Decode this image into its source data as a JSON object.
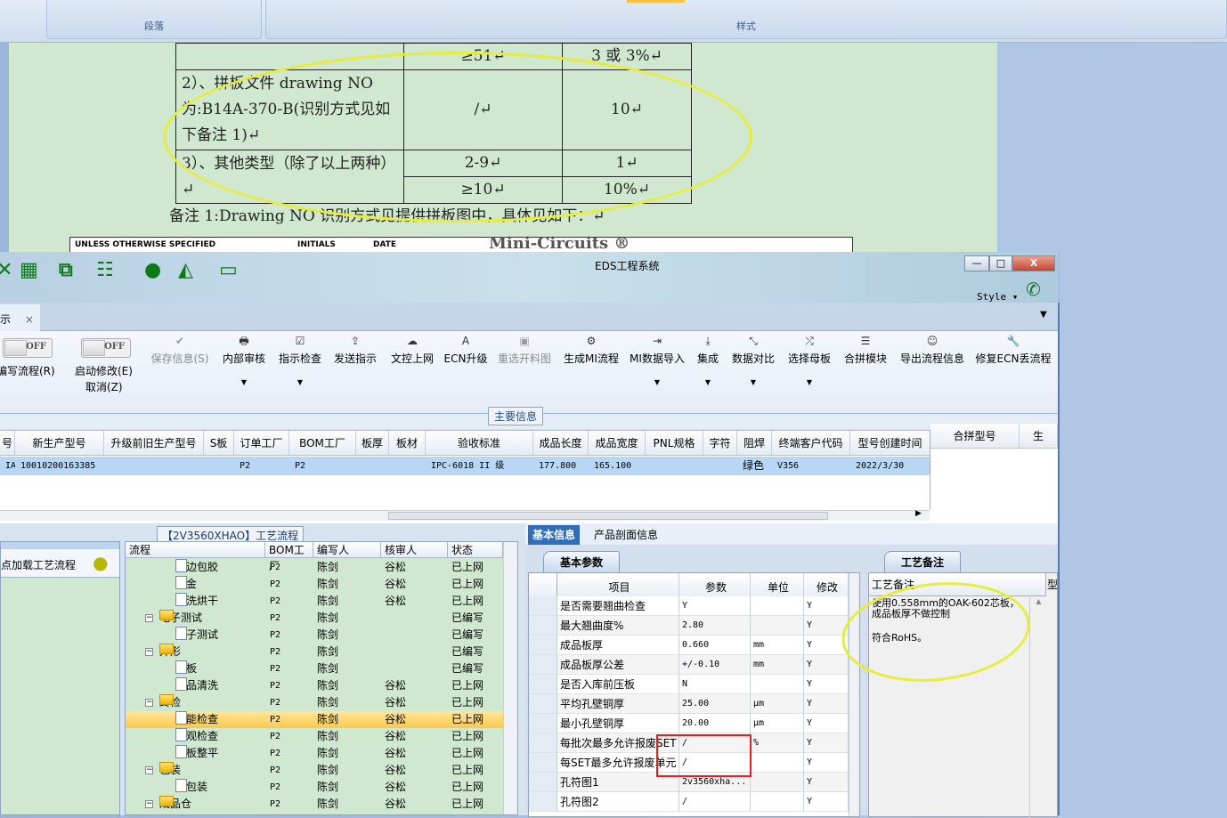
{
  "word": {
    "ribbon_groups": [
      "段落",
      "样式"
    ],
    "table": [
      [
        "",
        "≥51↵",
        "3 或 3%↵"
      ],
      [
        "2）、拼板文件 drawing NO 为:B14A-370-B(识别方式见如下备注 1)↵",
        "/↵",
        "10↵"
      ],
      [
        "3）、其他类型（除了以上两种）↵",
        "2-9↵",
        "1↵"
      ],
      [
        "",
        "≥10↵",
        "10%↵"
      ]
    ],
    "note": "备注 1:Drawing NO 识别方式见提供拼板图中，具体见如下：↵",
    "drawing_strip": [
      "UNLESS OTHERWISE SPECIFIED",
      "INITIALS",
      "DATE",
      "Mini-Circuits ®"
    ]
  },
  "app": {
    "title": "EDS工程系统",
    "style_label": "Style ▾",
    "window_controls": {
      "minimize": "—",
      "maximize": "□",
      "close": "X"
    },
    "doc_tab": {
      "label": "示",
      "close": "×"
    },
    "toggles": [
      {
        "state": "OFF",
        "label": "编写流程(R)"
      },
      {
        "state": "OFF",
        "label": "启动修改(E)",
        "label2": "取消(Z)"
      }
    ],
    "toolbar": [
      {
        "label": "保存信息(S)",
        "icon": "✔",
        "disabled": true
      },
      {
        "label": "内部审核",
        "icon": "🖶",
        "dropdown": true
      },
      {
        "label": "指示检查",
        "icon": "☑",
        "dropdown": true
      },
      {
        "label": "发送指示",
        "icon": "⇪"
      },
      {
        "label": "文控上网",
        "icon": "☁"
      },
      {
        "label": "ECN升级",
        "icon": "A"
      },
      {
        "label": "重选开料图",
        "icon": "▣",
        "disabled": true
      },
      {
        "label": "生成MI流程",
        "icon": "⚙"
      },
      {
        "label": "MI数据导入",
        "icon": "⇥",
        "dropdown": true
      },
      {
        "label": "集成",
        "icon": "⤓",
        "dropdown": true
      },
      {
        "label": "数据对比",
        "icon": "⤡",
        "dropdown": true
      },
      {
        "label": "选择母板",
        "icon": "⤮",
        "dropdown": true
      },
      {
        "label": "合拼模块",
        "icon": "☰"
      },
      {
        "label": "导出流程信息",
        "icon": "☺"
      },
      {
        "label": "修复ECN丢流程",
        "icon": "🔧"
      }
    ],
    "group_label": "主要信息",
    "grid": {
      "columns": [
        "号",
        "新生产型号",
        "升级前旧生产型号",
        "S板",
        "订单工厂",
        "BOM工厂",
        "板厚",
        "板材",
        "验收标准",
        "成品长度",
        "成品宽度",
        "PNL规格",
        "字符",
        "阻焊",
        "终端客户代码",
        "型号创建时间"
      ],
      "row": [
        "IAO",
        "10010200163385",
        "",
        "",
        "P2",
        "P2",
        "",
        "",
        "IPC-6018 II 级",
        "177.800",
        "165.100",
        "",
        "",
        "绿色",
        "V356",
        "2022/3/30"
      ],
      "side_columns": [
        "合拼型号",
        "生"
      ]
    },
    "left_panel": {
      "label": "点加载工艺流程"
    },
    "tree": {
      "caption": "【2V3560XHAO】工艺流程",
      "columns": [
        "流程",
        "BOM工厂",
        "编写人",
        "核审人",
        "状态"
      ],
      "rows": [
        {
          "name": "板边包胶",
          "type": "file",
          "bom": "P2",
          "writer": "陈剑",
          "reviewer": "谷松",
          "status": "已上网"
        },
        {
          "name": "沉金",
          "type": "file",
          "bom": "P2",
          "writer": "陈剑",
          "reviewer": "谷松",
          "status": "已上网"
        },
        {
          "name": "水洗烘干",
          "type": "file",
          "bom": "P2",
          "writer": "陈剑",
          "reviewer": "谷松",
          "status": "已上网"
        },
        {
          "name": "电子测试",
          "type": "folder",
          "bom": "P2",
          "writer": "陈剑",
          "reviewer": "",
          "status": "已编写"
        },
        {
          "name": "电子测试",
          "type": "file",
          "bom": "P2",
          "writer": "陈剑",
          "reviewer": "",
          "status": "已编写"
        },
        {
          "name": "外形",
          "type": "folder",
          "bom": "P2",
          "writer": "陈剑",
          "reviewer": "",
          "status": "已编写"
        },
        {
          "name": "铣板",
          "type": "file",
          "bom": "P2",
          "writer": "陈剑",
          "reviewer": "",
          "status": "已编写"
        },
        {
          "name": "成品清洗",
          "type": "file",
          "bom": "P2",
          "writer": "陈剑",
          "reviewer": "谷松",
          "status": "已上网"
        },
        {
          "name": "终检",
          "type": "folder",
          "bom": "P2",
          "writer": "陈剑",
          "reviewer": "谷松",
          "status": "已上网"
        },
        {
          "name": "功能检查",
          "type": "file",
          "bom": "P2",
          "writer": "陈剑",
          "reviewer": "谷松",
          "status": "已上网",
          "selected": true
        },
        {
          "name": "外观检查",
          "type": "file",
          "bom": "P2",
          "writer": "陈剑",
          "reviewer": "谷松",
          "status": "已上网"
        },
        {
          "name": "烘板整平",
          "type": "file",
          "bom": "P2",
          "writer": "陈剑",
          "reviewer": "谷松",
          "status": "已上网"
        },
        {
          "name": "包装",
          "type": "folder",
          "bom": "P2",
          "writer": "陈剑",
          "reviewer": "谷松",
          "status": "已上网"
        },
        {
          "name": "内包装",
          "type": "file",
          "bom": "P2",
          "writer": "陈剑",
          "reviewer": "谷松",
          "status": "已上网"
        },
        {
          "name": "成品仓",
          "type": "folder",
          "bom": "P2",
          "writer": "陈剑",
          "reviewer": "谷松",
          "status": "已上网"
        }
      ]
    },
    "info_tabs": [
      "基本信息",
      "产品剖面信息"
    ],
    "params": {
      "tab": "基本参数",
      "columns": [
        "项目",
        "参数",
        "单位",
        "修改"
      ],
      "rows": [
        [
          "是否需要翘曲检查",
          "Y",
          "",
          "Y"
        ],
        [
          "最大翘曲度%",
          "2.80",
          "",
          "Y"
        ],
        [
          "成品板厚",
          "0.660",
          "mm",
          "Y"
        ],
        [
          "成品板厚公差",
          "+/-0.10",
          "mm",
          "Y"
        ],
        [
          "是否入库前压板",
          "N",
          "",
          "Y"
        ],
        [
          "平均孔壁铜厚",
          "25.00",
          "μm",
          "Y"
        ],
        [
          "最小孔壁铜厚",
          "20.00",
          "μm",
          "Y"
        ],
        [
          "每批次最多允许报废SET",
          "/",
          "%",
          "Y"
        ],
        [
          "每SET最多允许报废单元",
          "/",
          "",
          "Y"
        ],
        [
          "孔符图1",
          "2v3560xha...",
          "",
          "Y"
        ],
        [
          "孔符图2",
          "/",
          "",
          "Y"
        ]
      ]
    },
    "notes": {
      "tab": "工艺备注",
      "column": "工艺备注",
      "side_column": "型",
      "lines": [
        "使用0.558mm的OAK-602芯板，成品板厚不做控制",
        "符合RoHS。"
      ]
    }
  }
}
